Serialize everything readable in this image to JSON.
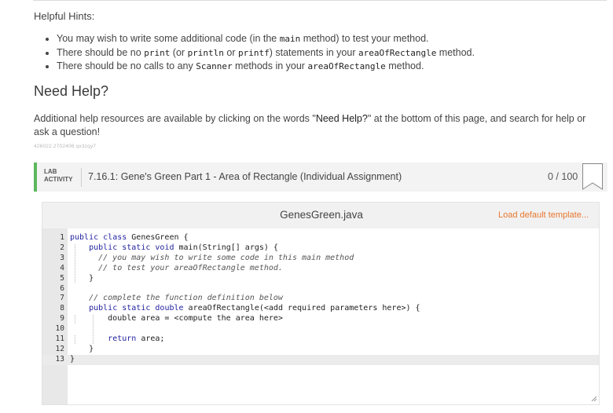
{
  "hints": {
    "title": "Helpful Hints:",
    "items": [
      [
        {
          "t": "You may wish to write some additional code (in the "
        },
        {
          "c": "main"
        },
        {
          "t": " method) to test your method."
        }
      ],
      [
        {
          "t": "There should be no "
        },
        {
          "c": "print"
        },
        {
          "t": " (or "
        },
        {
          "c": "println"
        },
        {
          "t": " or "
        },
        {
          "c": "printf"
        },
        {
          "t": ") statements in your "
        },
        {
          "c": "areaOfRectangle"
        },
        {
          "t": " method."
        }
      ],
      [
        {
          "t": "There should be no calls to any "
        },
        {
          "c": "Scanner"
        },
        {
          "t": " methods in your "
        },
        {
          "c": "areaOfRectangle"
        },
        {
          "t": " method."
        }
      ]
    ]
  },
  "need_help": {
    "title": "Need Help?",
    "text_before": "Additional help resources are available by clicking on the words \"",
    "text_link": "Need Help?",
    "text_after": "\" at the bottom of this page, and search for help or ask a question!",
    "tiny_id": "426022.2702406.qx3zqy7"
  },
  "lab": {
    "label_line1": "LAB",
    "label_line2": "ACTIVITY",
    "title": "7.16.1: Gene's Green Part 1 - Area of Rectangle (Individual Assignment)",
    "score": "0 / 100",
    "accent_color": "#5cb85c"
  },
  "ide": {
    "filename": "GenesGreen.java",
    "load_template": "Load default template...",
    "active_line": 13,
    "lines": [
      {
        "n": "1",
        "segs": [
          {
            "k": "public"
          },
          {
            "t": " "
          },
          {
            "k": "class"
          },
          {
            "t": " GenesGreen {"
          }
        ]
      },
      {
        "n": "2",
        "segs": [
          {
            "t": "    "
          },
          {
            "k": "public"
          },
          {
            "t": " "
          },
          {
            "k": "static"
          },
          {
            "t": " "
          },
          {
            "k": "void"
          },
          {
            "t": " main(String[] args) {"
          }
        ]
      },
      {
        "n": "3",
        "segs": [
          {
            "t": "      "
          },
          {
            "m": "// you may wish to write some code in this main method"
          }
        ]
      },
      {
        "n": "4",
        "segs": [
          {
            "t": "      "
          },
          {
            "m": "// to test your areaOfRectangle method."
          }
        ]
      },
      {
        "n": "5",
        "segs": [
          {
            "t": "    }"
          }
        ]
      },
      {
        "n": "6",
        "segs": []
      },
      {
        "n": "7",
        "segs": [
          {
            "t": "    "
          },
          {
            "m": "// complete the function definition below"
          }
        ]
      },
      {
        "n": "8",
        "segs": [
          {
            "t": "    "
          },
          {
            "k": "public"
          },
          {
            "t": " "
          },
          {
            "k": "static"
          },
          {
            "t": " "
          },
          {
            "k": "double"
          },
          {
            "t": " areaOfRectangle(<add required parameters here>) {"
          }
        ]
      },
      {
        "n": "9",
        "segs": [
          {
            "t": "        double area = <compute the area here>"
          }
        ]
      },
      {
        "n": "10",
        "segs": []
      },
      {
        "n": "11",
        "segs": [
          {
            "t": "        "
          },
          {
            "k": "return"
          },
          {
            "t": " area;"
          }
        ]
      },
      {
        "n": "12",
        "segs": [
          {
            "t": "    }"
          }
        ]
      },
      {
        "n": "13",
        "segs": [
          {
            "t": "}"
          }
        ]
      }
    ]
  }
}
